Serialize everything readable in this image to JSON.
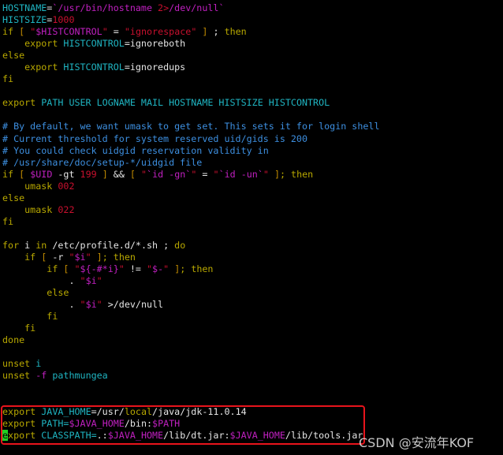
{
  "editor": {
    "lines": [
      [
        [
          "HOSTNAME",
          "c"
        ],
        [
          "=",
          "w"
        ],
        [
          "`/usr/bin/hostname ",
          "v"
        ],
        [
          "2>",
          "s"
        ],
        [
          "/dev/null`",
          "v"
        ]
      ],
      [
        [
          "HISTSIZE",
          "c"
        ],
        [
          "=",
          "w"
        ],
        [
          "1000",
          "s"
        ]
      ],
      [
        [
          "if ",
          "k"
        ],
        [
          "[ ",
          "o"
        ],
        [
          "\"",
          "s"
        ],
        [
          "$HISTCONTROL",
          "v"
        ],
        [
          "\"",
          "s"
        ],
        [
          " = ",
          "w"
        ],
        [
          "\"ignorespace\"",
          "s"
        ],
        [
          " ] ",
          "o"
        ],
        [
          "; ",
          "w"
        ],
        [
          "then",
          "k"
        ]
      ],
      [
        [
          "    export ",
          "k"
        ],
        [
          "HISTCONTROL",
          "c"
        ],
        [
          "=ignoreboth",
          "w"
        ]
      ],
      [
        [
          "else",
          "k"
        ]
      ],
      [
        [
          "    export ",
          "k"
        ],
        [
          "HISTCONTROL",
          "c"
        ],
        [
          "=ignoredups",
          "w"
        ]
      ],
      [
        [
          "fi",
          "k"
        ]
      ],
      [],
      [
        [
          "export ",
          "k"
        ],
        [
          "PATH USER LOGNAME MAIL HOSTNAME HISTSIZE HISTCONTROL",
          "c"
        ]
      ],
      [],
      [
        [
          "# By default, we want umask to get set. This sets it for login shell",
          "b"
        ]
      ],
      [
        [
          "# Current threshold for system reserved uid/gids is 200",
          "b"
        ]
      ],
      [
        [
          "# You could check uidgid reservation validity in",
          "b"
        ]
      ],
      [
        [
          "# /usr/share/doc/setup-*/uidgid file",
          "b"
        ]
      ],
      [
        [
          "if ",
          "k"
        ],
        [
          "[ ",
          "o"
        ],
        [
          "$UID",
          "v"
        ],
        [
          " -gt ",
          "w"
        ],
        [
          "199",
          "s"
        ],
        [
          " ] ",
          "o"
        ],
        [
          "&& ",
          "w"
        ],
        [
          "[ ",
          "o"
        ],
        [
          "\"",
          "s"
        ],
        [
          "`id -gn`",
          "v"
        ],
        [
          "\"",
          "s"
        ],
        [
          " = ",
          "w"
        ],
        [
          "\"",
          "s"
        ],
        [
          "`id -un`",
          "v"
        ],
        [
          "\"",
          "s"
        ],
        [
          " ]",
          "o"
        ],
        [
          "; then",
          "k"
        ]
      ],
      [
        [
          "    umask ",
          "k"
        ],
        [
          "002",
          "s"
        ]
      ],
      [
        [
          "else",
          "k"
        ]
      ],
      [
        [
          "    umask ",
          "k"
        ],
        [
          "022",
          "s"
        ]
      ],
      [
        [
          "fi",
          "k"
        ]
      ],
      [],
      [
        [
          "for",
          "k"
        ],
        [
          " i ",
          "w"
        ],
        [
          "in",
          "k"
        ],
        [
          " /etc/profile.d/*.sh ; ",
          "w"
        ],
        [
          "do",
          "k"
        ]
      ],
      [
        [
          "    if ",
          "k"
        ],
        [
          "[ ",
          "o"
        ],
        [
          "-r ",
          "w"
        ],
        [
          "\"",
          "s"
        ],
        [
          "$i",
          "v"
        ],
        [
          "\"",
          "s"
        ],
        [
          " ]",
          "o"
        ],
        [
          "; then",
          "k"
        ]
      ],
      [
        [
          "        if ",
          "k"
        ],
        [
          "[ ",
          "o"
        ],
        [
          "\"",
          "s"
        ],
        [
          "${-#*i}",
          "v"
        ],
        [
          "\"",
          "s"
        ],
        [
          " != ",
          "w"
        ],
        [
          "\"",
          "s"
        ],
        [
          "$-",
          "v"
        ],
        [
          "\"",
          "s"
        ],
        [
          " ]",
          "o"
        ],
        [
          "; then",
          "k"
        ]
      ],
      [
        [
          "            . ",
          "w"
        ],
        [
          "\"",
          "s"
        ],
        [
          "$i",
          "v"
        ],
        [
          "\"",
          "s"
        ]
      ],
      [
        [
          "        else",
          "k"
        ]
      ],
      [
        [
          "            . ",
          "w"
        ],
        [
          "\"",
          "s"
        ],
        [
          "$i",
          "v"
        ],
        [
          "\"",
          "s"
        ],
        [
          " >/dev/null",
          "w"
        ]
      ],
      [
        [
          "        fi",
          "k"
        ]
      ],
      [
        [
          "    fi",
          "k"
        ]
      ],
      [
        [
          "done",
          "k"
        ]
      ],
      [],
      [
        [
          "unset",
          "k"
        ],
        [
          " i",
          "c"
        ]
      ],
      [
        [
          "unset ",
          "k"
        ],
        [
          "-f",
          "v"
        ],
        [
          " pathmungea",
          "c"
        ]
      ],
      [],
      [],
      [
        [
          "export",
          "k"
        ],
        [
          " JAVA_HOME",
          "c"
        ],
        [
          "=/usr/",
          "w"
        ],
        [
          "local",
          "k"
        ],
        [
          "/java/jdk-11.0.14",
          "w"
        ]
      ],
      [
        [
          "export",
          "k"
        ],
        [
          " PATH=",
          "c"
        ],
        [
          "$JAVA_HOME",
          "v"
        ],
        [
          "/bin:",
          "w"
        ],
        [
          "$PATH",
          "v"
        ]
      ],
      [
        [
          "e",
          "cur"
        ],
        [
          "xport",
          "k"
        ],
        [
          " CLASSPATH=",
          "c"
        ],
        [
          ".:",
          "w"
        ],
        [
          "$JAVA_HOME",
          "v"
        ],
        [
          "/lib/dt.jar:",
          "w"
        ],
        [
          "$JAVA_HOME",
          "v"
        ],
        [
          "/lib/tools.jar",
          "w"
        ]
      ]
    ]
  },
  "colors": {
    "keyword": "#b8a800",
    "identifier": "#1fb5c2",
    "string": "#c8102e",
    "variable": "#c020c0",
    "comment": "#3d8fe0",
    "highlight_box": "#e8141c",
    "cursor": "#22d022"
  },
  "watermark": "CSDN @安流年KOF"
}
